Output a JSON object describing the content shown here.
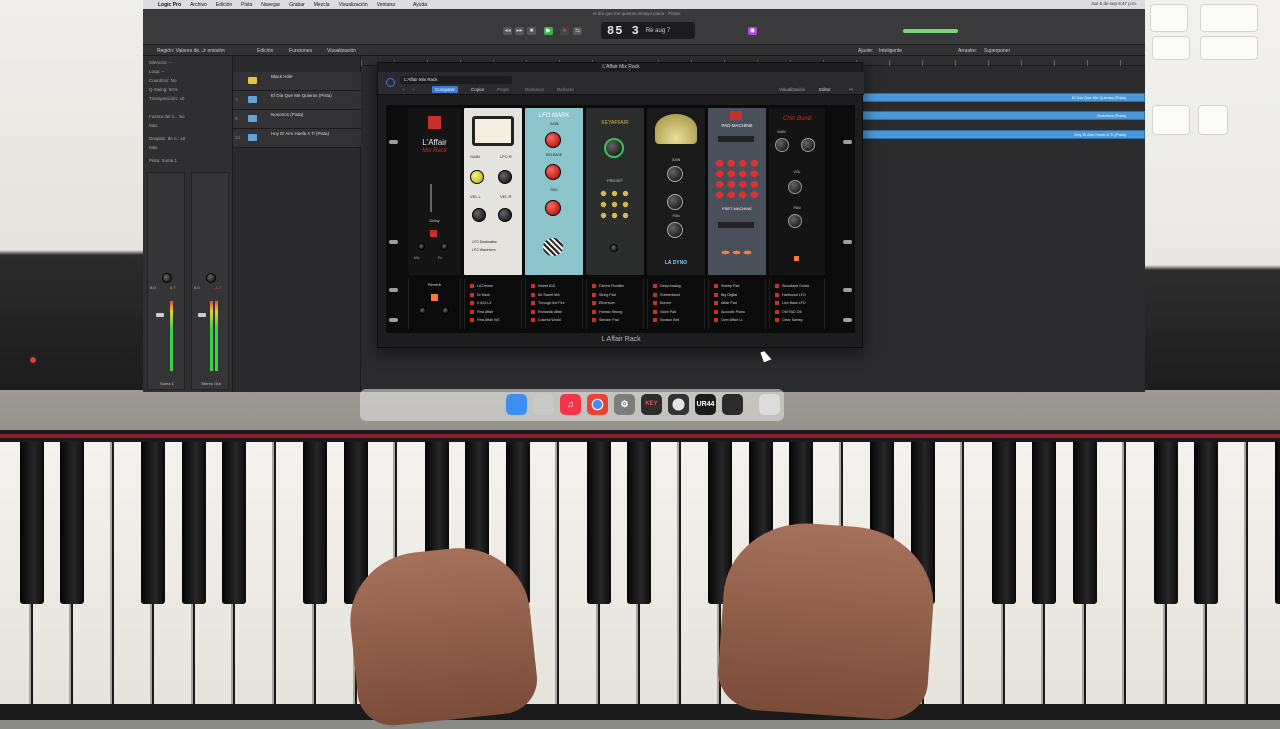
{
  "menubar": {
    "apple": "",
    "items": [
      "Logic Pro",
      "Archivo",
      "Edición",
      "Pista",
      "Navegar",
      "Grabar",
      "Mezcla",
      "Visualización",
      "Ventana",
      "",
      "Ayuda"
    ],
    "status": "Jue 5 de sep  6:47 p.m."
  },
  "toolbar": {
    "window_title": "el día que me quieras ensayo piano - Pistas",
    "position": "85  3",
    "key": "Re aug 7"
  },
  "subbar": {
    "region_label": "Región: Valores de...ir omisión",
    "edit": "Edición",
    "functions": "Funciones",
    "view": "Visualización",
    "adjust_label": "Ajuste:",
    "adjust_value": "Inteligente",
    "drag_label": "Arrastre:",
    "drag_value": "Superponer"
  },
  "inspector": {
    "rows": [
      "Silenciar: --",
      "Loop: --",
      "Cuantizar: No",
      "Q-Swing: 50%",
      "Transposición: ±0",
      "",
      "Fuerza del ti... No",
      "Mas",
      "Desplaz. de n.: ±0",
      "Más",
      "Pista: Suma 1"
    ],
    "strip1": {
      "name": "Suma 1",
      "value1": "0,0",
      "value2": "0,7"
    },
    "strip2": {
      "name": "Stereo Out",
      "value1": "0,0",
      "value2": "-1,7"
    }
  },
  "tracks": [
    {
      "num": "",
      "name": "Black Hole"
    },
    {
      "num": "7",
      "name": "El Día Que Me Quieras (Pista)"
    },
    {
      "num": "9",
      "name": "Nosotros (Pista)"
    },
    {
      "num": "14",
      "name": "Hoy El Aire Huele A Ti (Pista)"
    }
  ],
  "regions": [
    {
      "label": "El Día Que Me Quieras (Pista)"
    },
    {
      "label": "Nosotros (Pista)"
    },
    {
      "label": "Hoy El Aire Huele A Ti (Pista)"
    }
  ],
  "plugin": {
    "title": "L'Affair Mix Rack",
    "preset": "L'Affair Mix Rack",
    "compare": "Comparar",
    "copy": "Copiar",
    "paste": "Pegar",
    "undo": "Deshacer",
    "redo": "Rehacer",
    "view": "Visualización",
    "editor": "Editor",
    "rack_name": "L Affair Rack",
    "modules": [
      {
        "name": "L'Affair",
        "subtitle": "Mix Rack",
        "labels": [
          "Reverb",
          "Delay",
          "Mix",
          "Fx"
        ]
      },
      {
        "name": "",
        "labels": [
          "GAIN",
          "LFO R",
          "VEL L",
          "VEL R",
          "LFO Destination",
          "LFO Waveform"
        ]
      },
      {
        "name": "LFO MARK",
        "labels": [
          "GAIN",
          "RELEASE",
          "PAN"
        ]
      },
      {
        "name": "KEYAFFAIR",
        "labels": [
          "PRESET"
        ]
      },
      {
        "name": "LA DYNO",
        "labels": [
          "GAIN",
          "PAN"
        ]
      },
      {
        "name": "PAD MACHINE",
        "labels": [
          "FRET MACHINE"
        ]
      },
      {
        "name": "Chin Bond",
        "labels": [
          "GAIN",
          "VOL",
          "PAN"
        ]
      }
    ],
    "bottom_lists": [
      [
        "LA Drums",
        "Dr Mark",
        "X 813 L4",
        "First Affair",
        "First Affair W2"
      ],
      [
        "Sweet 815",
        "Mr Sweet Mix",
        "Through the Fire",
        "Romantic Affair",
        "Colorful World"
      ],
      [
        "Fairest Fluidlike",
        "String Pad",
        "Ethereum",
        "Human Strong",
        "Slender Pad"
      ],
      [
        "Deep Analog",
        "Rubberband",
        "Bonzer",
        "Voice Pad",
        "Scratch Bell"
      ],
      [
        "Sweep Pad",
        "Big Digital",
        "Affair Pad",
        "Acoustic Piano",
        "Over Affair LL"
      ],
      [
        "Woodland Guitar",
        "Harbound LFO",
        "Live Bass LFO",
        "Old FAD 3/5",
        "Clear Sweep"
      ]
    ]
  },
  "dock": {
    "icons": [
      "finder-icon",
      "launchpad-icon",
      "music-icon",
      "chrome-icon",
      "settings-icon",
      "keystage-icon",
      "logic-icon",
      "ur44-icon",
      "activity-icon",
      "trash-icon"
    ],
    "labels": [
      "",
      "",
      "♫",
      "",
      "⚙",
      "KEY",
      "",
      "UR44",
      "",
      ""
    ]
  },
  "colors": {
    "accent_blue": "#3d7bd9",
    "play_green": "#3bb54a",
    "region_blue": "#4a98d7",
    "rack_red": "#c8302c"
  }
}
